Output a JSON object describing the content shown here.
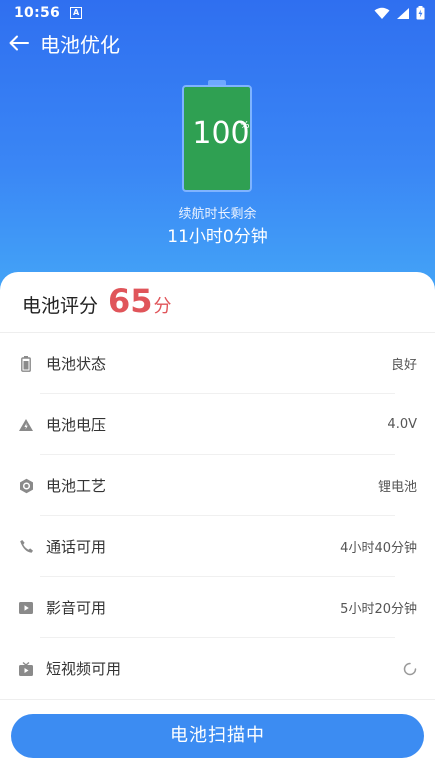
{
  "status_bar": {
    "time": "10:56",
    "badge": "A"
  },
  "header": {
    "title": "电池优化"
  },
  "battery": {
    "percent_text": "100",
    "percent_sign": "%",
    "level": 1.0
  },
  "remaining": {
    "label": "续航时长剩余",
    "value": "11小时0分钟"
  },
  "score": {
    "label": "电池评分",
    "value": "65",
    "unit": "分"
  },
  "items": [
    {
      "label": "电池状态",
      "value": "良好",
      "icon": "battery-icon"
    },
    {
      "label": "电池电压",
      "value": "4.0V",
      "icon": "voltage-icon"
    },
    {
      "label": "电池工艺",
      "value": "锂电池",
      "icon": "hexagon-icon"
    },
    {
      "label": "通话可用",
      "value": "4小时40分钟",
      "icon": "phone-icon"
    },
    {
      "label": "影音可用",
      "value": "5小时20分钟",
      "icon": "play-icon"
    },
    {
      "label": "短视频可用",
      "value": "",
      "icon": "short-video-icon"
    }
  ],
  "button": {
    "label": "电池扫描中"
  },
  "colors": {
    "accent": "#3c8cf2",
    "score": "#e0555a",
    "battery_fill": "#2fa052"
  }
}
